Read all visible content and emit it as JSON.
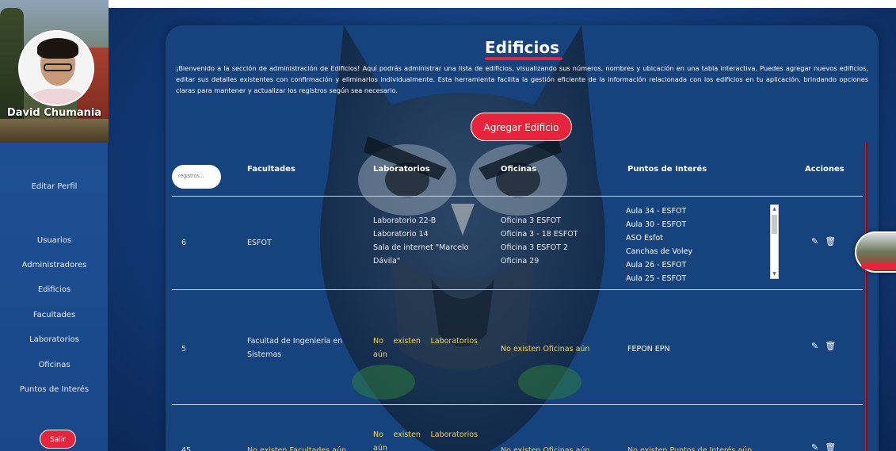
{
  "profile": {
    "name": "David Chumania"
  },
  "sidebar": {
    "items": [
      {
        "label": "Editar Perfil"
      },
      {
        "label": "Usuarios"
      },
      {
        "label": "Administradores"
      },
      {
        "label": "Edificios"
      },
      {
        "label": "Facultades"
      },
      {
        "label": "Laboratorios"
      },
      {
        "label": "Oficinas"
      },
      {
        "label": "Puntos de Interés"
      }
    ],
    "logout_label": "Salir"
  },
  "page": {
    "title": "Edificios",
    "intro": "¡Bienvenido a la sección de administración de Edificios! Aquí podrás administrar una lista de edificios, visualizando sus números, nombres y ubicación en una tabla interactiva. Puedes agregar nuevos edificios, editar sus detalles existentes con confirmación y eliminarlos individualmente. Esta herramienta facilita la gestión eficiente de la información relacionada con los edificios en tu aplicación, brindando opciones claras para mantener y actualizar los registros según sea necesario.",
    "add_button": "Agregar Edificio",
    "search_placeholder": "registros..."
  },
  "table": {
    "headers": {
      "facultades": "Facultades",
      "laboratorios": "Laboratorios",
      "oficinas": "Oficinas",
      "puntos": "Puntos de Interés",
      "acciones": "Acciones"
    },
    "rows": [
      {
        "number": "6",
        "facultad": "ESFOT",
        "laboratorios": [
          "Laboratorio 22-B",
          "Laboratorio 14",
          "Sala de internet \"Marcelo",
          "Dávila\""
        ],
        "oficinas": [
          "Oficina 3 ESFOT",
          "Oficina 3 - 18 ESFOT",
          "Oficina 3 ESFOT 2",
          "Oficina 29"
        ],
        "puntos": [
          "Aula 34 - ESFOT",
          "Aula 30 - ESFOT",
          "ASO Esfot",
          "Canchas de Voley",
          "Aula 26 - ESFOT",
          "Aula 25 - ESFOT"
        ]
      },
      {
        "number": "5",
        "facultad": [
          "Facultad de Ingeniería en",
          "Sistemas"
        ],
        "laboratorios_empty": [
          "No existen Laboratorios",
          "aún"
        ],
        "oficinas_empty": "No existen Oficinas aún",
        "puntos": "FEPON EPN"
      },
      {
        "number": "45",
        "facultad_empty": "No existen Facultades aún",
        "laboratorios_empty": [
          "No existen Laboratorios",
          "aún"
        ],
        "oficinas_empty": "No existen Oficinas aún",
        "puntos_empty": "No existen Puntos de Interés aún"
      }
    ]
  },
  "icons": {
    "edit": "✎",
    "delete": "🗑",
    "scroll_up": "▲",
    "scroll_down": "▼"
  },
  "colors": {
    "accent": "#e8243c",
    "panel": "#16427e",
    "sidebar": "#1d4f93",
    "empty_text": "#f2d35a"
  }
}
